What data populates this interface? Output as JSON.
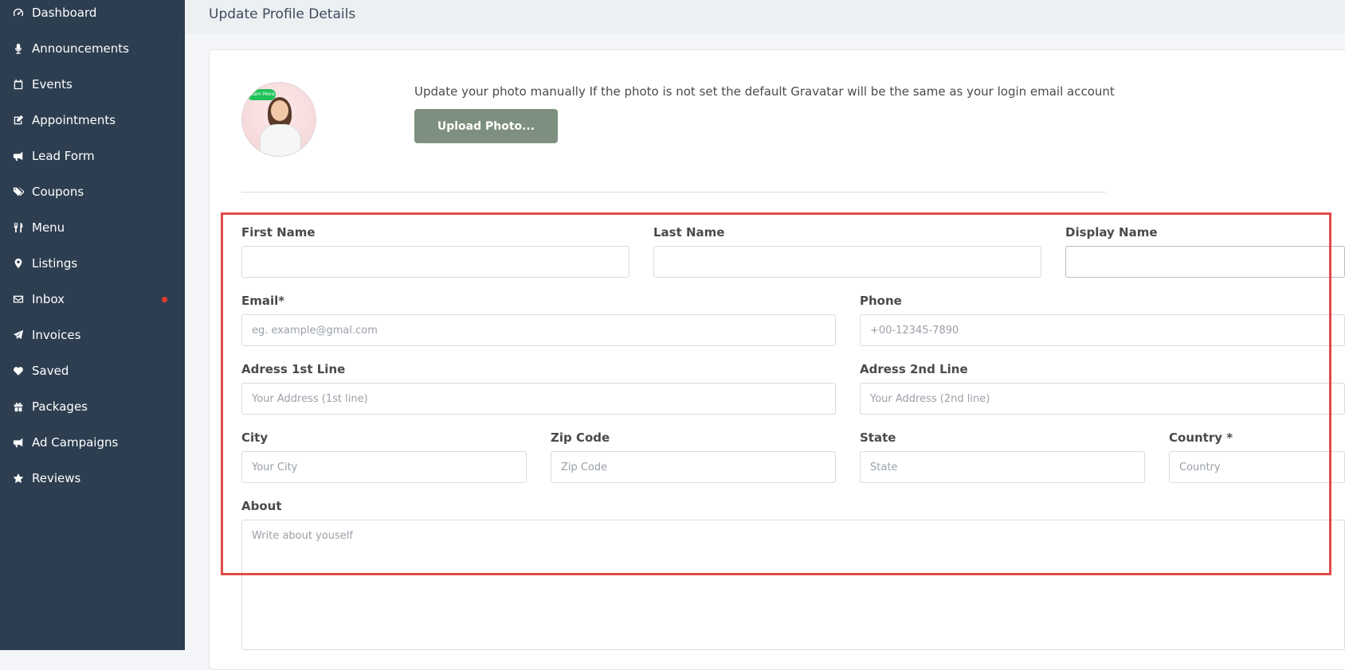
{
  "sidebar": {
    "items": [
      {
        "label": "Dashboard",
        "icon": "dashboard-icon"
      },
      {
        "label": "Announcements",
        "icon": "microphone-icon"
      },
      {
        "label": "Events",
        "icon": "calendar-icon"
      },
      {
        "label": "Appointments",
        "icon": "edit-icon"
      },
      {
        "label": "Lead Form",
        "icon": "megaphone-icon"
      },
      {
        "label": "Coupons",
        "icon": "tags-icon"
      },
      {
        "label": "Menu",
        "icon": "utensils-icon"
      },
      {
        "label": "Listings",
        "icon": "map-marker-icon"
      },
      {
        "label": "Inbox",
        "icon": "envelope-icon",
        "has_notification": true
      },
      {
        "label": "Invoices",
        "icon": "paper-plane-icon"
      },
      {
        "label": "Saved",
        "icon": "heart-icon"
      },
      {
        "label": "Packages",
        "icon": "gift-icon"
      },
      {
        "label": "Ad Campaigns",
        "icon": "megaphone-icon"
      },
      {
        "label": "Reviews",
        "icon": "star-icon"
      }
    ],
    "notification_color": "#e8392f"
  },
  "header": {
    "title": "Update Profile Details"
  },
  "photo": {
    "badge_text": "Learn More",
    "instructions": "Update your photo manually If the photo is not set the default Gravatar will be the same as your login email account",
    "upload_label": "Upload Photo..."
  },
  "form": {
    "first_name": {
      "label": "First Name",
      "placeholder": ""
    },
    "last_name": {
      "label": "Last Name",
      "placeholder": ""
    },
    "display_name": {
      "label": "Display Name",
      "placeholder": ""
    },
    "email": {
      "label": "Email*",
      "placeholder": "eg. example@gmal.com"
    },
    "phone": {
      "label": "Phone",
      "placeholder": "+00-12345-7890"
    },
    "address1": {
      "label": "Adress 1st Line",
      "placeholder": "Your Address (1st line)"
    },
    "address2": {
      "label": "Adress 2nd Line",
      "placeholder": "Your Address (2nd line)"
    },
    "city": {
      "label": "City",
      "placeholder": "Your City"
    },
    "zip": {
      "label": "Zip Code",
      "placeholder": "Zip Code"
    },
    "state": {
      "label": "State",
      "placeholder": "State"
    },
    "country": {
      "label": "Country *",
      "placeholder": "Country"
    },
    "about": {
      "label": "About",
      "placeholder": "Write about youself"
    }
  },
  "colors": {
    "sidebar_bg": "#2c3e50",
    "button_bg": "#7d8f7e",
    "highlight_border": "#e24a4a"
  }
}
